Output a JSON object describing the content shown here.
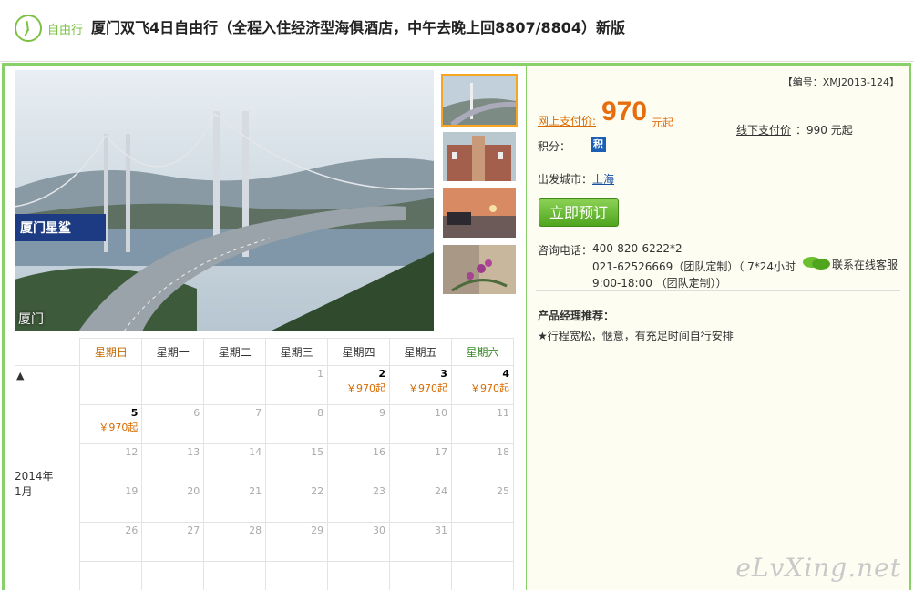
{
  "header": {
    "badge": "自由行",
    "title": "厦门双飞4日自由行（全程入住经济型海俱酒店，中午去晚上回8807/8804）新版"
  },
  "gallery": {
    "main_caption": "厦门",
    "main_sign_text": "厦门星鲨",
    "thumbnails": [
      "bridge",
      "building",
      "sunset-harbor",
      "flowers"
    ]
  },
  "calendar": {
    "weekdays": [
      "星期日",
      "星期一",
      "星期二",
      "星期三",
      "星期四",
      "星期五",
      "星期六"
    ],
    "year": "2014年",
    "month": "1月",
    "up_arrow": "▲",
    "down_arrow": "▼",
    "weeks": [
      [
        {
          "d": ""
        },
        {
          "d": ""
        },
        {
          "d": ""
        },
        {
          "d": "1"
        },
        {
          "d": "2",
          "p": "￥970起",
          "on": true
        },
        {
          "d": "3",
          "p": "￥970起",
          "on": true
        },
        {
          "d": "4",
          "p": "￥970起",
          "on": true
        }
      ],
      [
        {
          "d": "5",
          "p": "￥970起",
          "on": true
        },
        {
          "d": "6"
        },
        {
          "d": "7"
        },
        {
          "d": "8"
        },
        {
          "d": "9"
        },
        {
          "d": "10"
        },
        {
          "d": "11"
        }
      ],
      [
        {
          "d": "12"
        },
        {
          "d": "13"
        },
        {
          "d": "14"
        },
        {
          "d": "15"
        },
        {
          "d": "16"
        },
        {
          "d": "17"
        },
        {
          "d": "18"
        }
      ],
      [
        {
          "d": "19"
        },
        {
          "d": "20"
        },
        {
          "d": "21"
        },
        {
          "d": "22"
        },
        {
          "d": "23"
        },
        {
          "d": "24"
        },
        {
          "d": "25"
        }
      ],
      [
        {
          "d": "26"
        },
        {
          "d": "27"
        },
        {
          "d": "28"
        },
        {
          "d": "29"
        },
        {
          "d": "30"
        },
        {
          "d": "31"
        },
        {
          "d": ""
        }
      ],
      [
        {
          "d": ""
        },
        {
          "d": ""
        },
        {
          "d": ""
        },
        {
          "d": ""
        },
        {
          "d": ""
        },
        {
          "d": ""
        },
        {
          "d": ""
        }
      ]
    ]
  },
  "info": {
    "code": "【编号：XMJ2013-124】",
    "online_label": "网上支付价:",
    "online_price": "970",
    "online_unit": "元起",
    "offline_label": "线下支付价",
    "offline_price": "：990 元起",
    "points_label": "积分：",
    "points_badge": "积",
    "city_label": "出发城市：",
    "city": "上海",
    "book_button": "立即预订",
    "phone_label": "咨询电话：",
    "phone1": "400-820-6222*2",
    "phone2": "021-62526669（团队定制）（ 7*24小时",
    "phone_hours": "9:00-18:00 （团队定制））",
    "service_text": "联系在线客服",
    "manager_title": "产品经理推荐：",
    "manager_text": "★行程宽松，惬意，有充足时间自行安排",
    "watermark": "eLvXing.net"
  },
  "colors": {
    "accent_green": "#8ad06a",
    "price_orange": "#e66e0f",
    "button_green": "#4fa51e"
  }
}
